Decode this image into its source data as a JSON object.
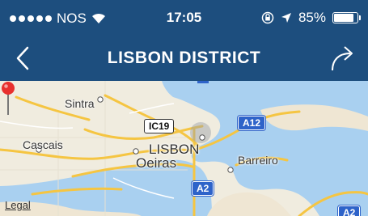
{
  "status_bar": {
    "carrier": "NOS",
    "time": "17:05",
    "battery": "85%",
    "battery_level": 0.85
  },
  "nav": {
    "title": "LISBON DISTRICT"
  },
  "map": {
    "places": {
      "sintra": "Sintra",
      "cascais": "Cascais",
      "lisbon": "LISBON",
      "oeiras": "Oeiras",
      "barreiro": "Barreiro"
    },
    "roads": {
      "ic19": "IC19",
      "a12": "A12",
      "a2": "A2",
      "a2_lower": "A2"
    },
    "legal": "Legal"
  },
  "colors": {
    "navbar": "#1d4e7e",
    "water": "#a9d0f0",
    "land": "#f0ecdf",
    "road": "#f5c542",
    "pin": "#e8302e"
  }
}
